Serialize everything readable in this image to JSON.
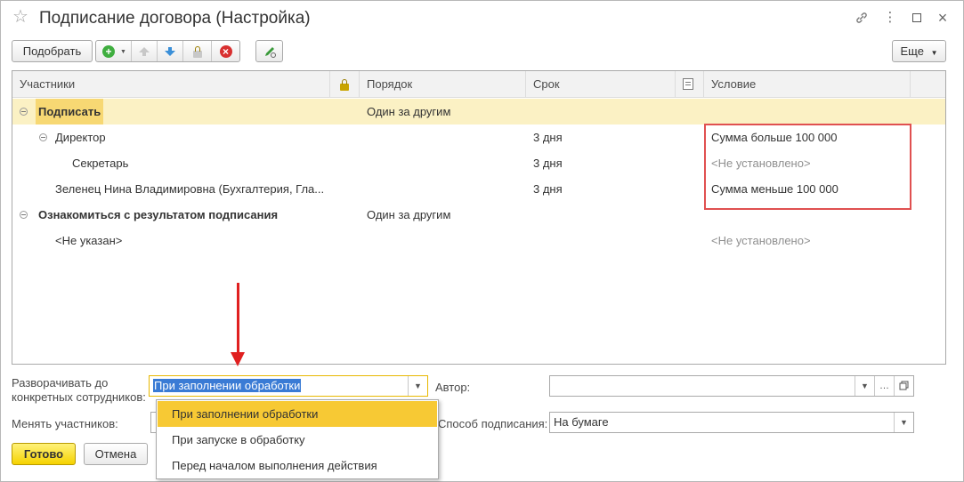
{
  "window": {
    "title": "Подписание договора (Настройка)"
  },
  "toolbar": {
    "pick_label": "Подобрать",
    "more_label": "Еще"
  },
  "table": {
    "columns": {
      "participants": "Участники",
      "order": "Порядок",
      "term": "Срок",
      "condition": "Условие"
    },
    "rows": [
      {
        "participant": "Подписать",
        "order": "Один за другим",
        "term": "",
        "condition": ""
      },
      {
        "participant": "Директор",
        "order": "",
        "term": "3 дня",
        "condition": "Сумма больше 100 000"
      },
      {
        "participant": "Секретарь",
        "order": "",
        "term": "3 дня",
        "condition": "<Не установлено>"
      },
      {
        "participant": "Зеленец Нина Владимировна (Бухгалтерия, Гла...",
        "order": "",
        "term": "3 дня",
        "condition": "Сумма меньше 100 000"
      },
      {
        "participant": "Ознакомиться с результатом подписания",
        "order": "Один за другим",
        "term": "",
        "condition": ""
      },
      {
        "participant": "<Не указан>",
        "order": "",
        "term": "",
        "condition": "<Не установлено>"
      }
    ]
  },
  "form": {
    "expand_label_line1": "Разворачивать до",
    "expand_label_line2": "конкретных сотрудников:",
    "expand_value": "При заполнении обработки",
    "author_label": "Автор:",
    "author_value": "",
    "change_label": "Менять участников:",
    "sign_method_label": "Способ подписания:",
    "sign_method_value": "На бумаге"
  },
  "dropdown": {
    "options": [
      "При заполнении обработки",
      "При запуске в обработку",
      "Перед началом выполнения действия"
    ],
    "selected_index": 0
  },
  "footer": {
    "ok_label": "Готово",
    "cancel_label": "Отмена"
  },
  "colors": {
    "selected_row": "#fbf1c4",
    "accent_yellow": "#f7c934",
    "annotation_red": "#e05050"
  }
}
